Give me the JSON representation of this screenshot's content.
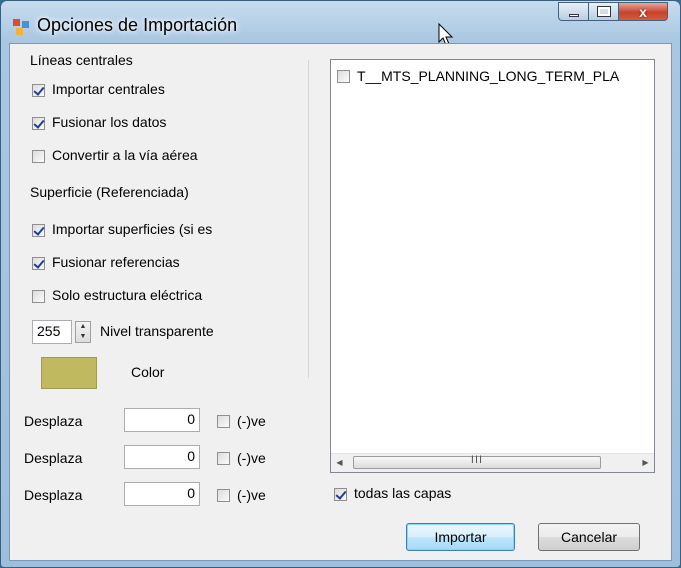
{
  "window": {
    "title": "Opciones de Importación",
    "close_glyph": "x"
  },
  "centerlines": {
    "heading": "Líneas centrales",
    "options": [
      {
        "label": "Importar centrales",
        "checked": true
      },
      {
        "label": "Fusionar los datos",
        "checked": true
      },
      {
        "label": "Convertir a la vía aérea",
        "checked": false
      }
    ]
  },
  "surface": {
    "heading": "Superficie (Referenciada)",
    "options": [
      {
        "label": "Importar superficies (si es",
        "checked": true
      },
      {
        "label": "Fusionar referencias",
        "checked": true
      },
      {
        "label": "Solo estructura eléctrica",
        "checked": false
      }
    ],
    "transparency_value": "255",
    "transparency_label": "Nivel transparente",
    "color_label": "Color",
    "color_value": "#c1b95f"
  },
  "offsets": [
    {
      "label": "Desplaza",
      "value": "0",
      "negate_label": "(-)ve",
      "checked": false
    },
    {
      "label": "Desplaza",
      "value": "0",
      "negate_label": "(-)ve",
      "checked": false
    },
    {
      "label": "Desplaza",
      "value": "0",
      "negate_label": "(-)ve",
      "checked": false
    }
  ],
  "layers": {
    "items": [
      {
        "label": "T__MTS_PLANNING_LONG_TERM_PLA",
        "checked": false
      }
    ],
    "scroll_grip": "III",
    "all_layers_label": "todas las capas",
    "all_layers_checked": true
  },
  "buttons": {
    "import": "Importar",
    "cancel": "Cancelar"
  }
}
